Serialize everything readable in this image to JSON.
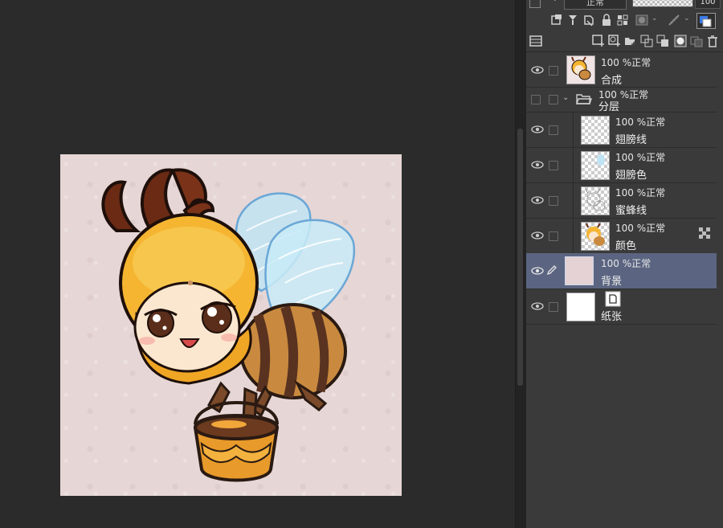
{
  "toolbar": {
    "blend_mode": "正常",
    "opacity_value": "100"
  },
  "layers": [
    {
      "opacity_blend": "100 %正常",
      "name": "合成"
    },
    {
      "opacity_blend": "100 %正常",
      "name": "分层"
    },
    {
      "opacity_blend": "100 %正常",
      "name": "翅膀线"
    },
    {
      "opacity_blend": "100 %正常",
      "name": "翅膀色"
    },
    {
      "opacity_blend": "100 %正常",
      "name": "蜜蜂线"
    },
    {
      "opacity_blend": "100 %正常",
      "name": "颜色"
    },
    {
      "opacity_blend": "100 %正常",
      "name": "背景"
    },
    {
      "name": "纸张"
    }
  ],
  "colors": {
    "workspace": "#2b2b2b",
    "panel": "#3a3a3a",
    "selected_row": "#5b6581",
    "artboard": "#e6d6d6",
    "accent_blue": "#3b7be8"
  }
}
